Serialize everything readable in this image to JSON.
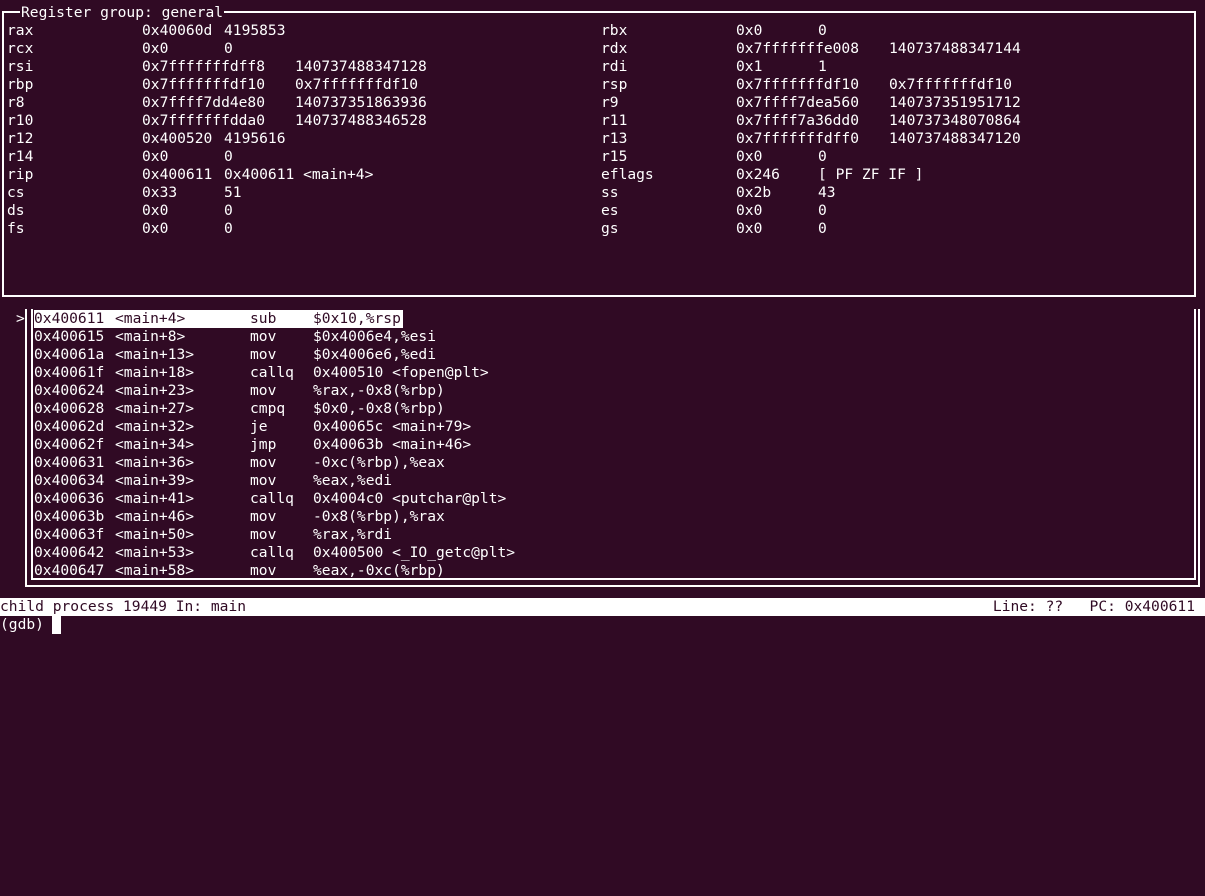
{
  "register_panel": {
    "title": "Register group: general",
    "registers": [
      {
        "name": "rax",
        "hex": "0x40060d",
        "dec": "4195853"
      },
      {
        "name": "rbx",
        "hex": "0x0",
        "dec": "0"
      },
      {
        "name": "rcx",
        "hex": "0x0",
        "dec": "0"
      },
      {
        "name": "rdx",
        "hex": "0x7fffffffe008",
        "dec": "140737488347144"
      },
      {
        "name": "rsi",
        "hex": "0x7fffffffdff8",
        "dec": "140737488347128"
      },
      {
        "name": "rdi",
        "hex": "0x1",
        "dec": "1"
      },
      {
        "name": "rbp",
        "hex": "0x7fffffffdf10",
        "dec": "0x7fffffffdf10"
      },
      {
        "name": "rsp",
        "hex": "0x7fffffffdf10",
        "dec": "0x7fffffffdf10"
      },
      {
        "name": "r8",
        "hex": "0x7ffff7dd4e80",
        "dec": "140737351863936"
      },
      {
        "name": "r9",
        "hex": "0x7ffff7dea560",
        "dec": "140737351951712"
      },
      {
        "name": "r10",
        "hex": "0x7fffffffdda0",
        "dec": "140737488346528"
      },
      {
        "name": "r11",
        "hex": "0x7ffff7a36dd0",
        "dec": "140737348070864"
      },
      {
        "name": "r12",
        "hex": "0x400520",
        "dec": "4195616"
      },
      {
        "name": "r13",
        "hex": "0x7fffffffdff0",
        "dec": "140737488347120"
      },
      {
        "name": "r14",
        "hex": "0x0",
        "dec": "0"
      },
      {
        "name": "r15",
        "hex": "0x0",
        "dec": "0"
      },
      {
        "name": "rip",
        "hex": "0x400611",
        "dec": "0x400611 <main+4>"
      },
      {
        "name": "eflags",
        "hex": "0x246",
        "dec": "[ PF ZF IF ]"
      },
      {
        "name": "cs",
        "hex": "0x33",
        "dec": "51"
      },
      {
        "name": "ss",
        "hex": "0x2b",
        "dec": "43"
      },
      {
        "name": "ds",
        "hex": "0x0",
        "dec": "0"
      },
      {
        "name": "es",
        "hex": "0x0",
        "dec": "0"
      },
      {
        "name": "fs",
        "hex": "0x0",
        "dec": "0"
      },
      {
        "name": "gs",
        "hex": "0x0",
        "dec": "0"
      }
    ]
  },
  "asm_panel": {
    "current_marker": ">",
    "instructions": [
      {
        "addr": "0x400611",
        "sym": "<main+4>",
        "op": "sub",
        "args": "$0x10,%rsp",
        "current": true
      },
      {
        "addr": "0x400615",
        "sym": "<main+8>",
        "op": "mov",
        "args": "$0x4006e4,%esi"
      },
      {
        "addr": "0x40061a",
        "sym": "<main+13>",
        "op": "mov",
        "args": "$0x4006e6,%edi"
      },
      {
        "addr": "0x40061f",
        "sym": "<main+18>",
        "op": "callq",
        "args": "0x400510 <fopen@plt>"
      },
      {
        "addr": "0x400624",
        "sym": "<main+23>",
        "op": "mov",
        "args": "%rax,-0x8(%rbp)"
      },
      {
        "addr": "0x400628",
        "sym": "<main+27>",
        "op": "cmpq",
        "args": "$0x0,-0x8(%rbp)"
      },
      {
        "addr": "0x40062d",
        "sym": "<main+32>",
        "op": "je",
        "args": "0x40065c <main+79>"
      },
      {
        "addr": "0x40062f",
        "sym": "<main+34>",
        "op": "jmp",
        "args": "0x40063b <main+46>"
      },
      {
        "addr": "0x400631",
        "sym": "<main+36>",
        "op": "mov",
        "args": "-0xc(%rbp),%eax"
      },
      {
        "addr": "0x400634",
        "sym": "<main+39>",
        "op": "mov",
        "args": "%eax,%edi"
      },
      {
        "addr": "0x400636",
        "sym": "<main+41>",
        "op": "callq",
        "args": "0x4004c0 <putchar@plt>"
      },
      {
        "addr": "0x40063b",
        "sym": "<main+46>",
        "op": "mov",
        "args": "-0x8(%rbp),%rax"
      },
      {
        "addr": "0x40063f",
        "sym": "<main+50>",
        "op": "mov",
        "args": "%rax,%rdi"
      },
      {
        "addr": "0x400642",
        "sym": "<main+53>",
        "op": "callq",
        "args": "0x400500 <_IO_getc@plt>"
      },
      {
        "addr": "0x400647",
        "sym": "<main+58>",
        "op": "mov",
        "args": "%eax,-0xc(%rbp)"
      }
    ]
  },
  "status": {
    "left": "child process 19449 In: main",
    "right": "Line: ??   PC: 0x400611"
  },
  "prompt": "(gdb) "
}
